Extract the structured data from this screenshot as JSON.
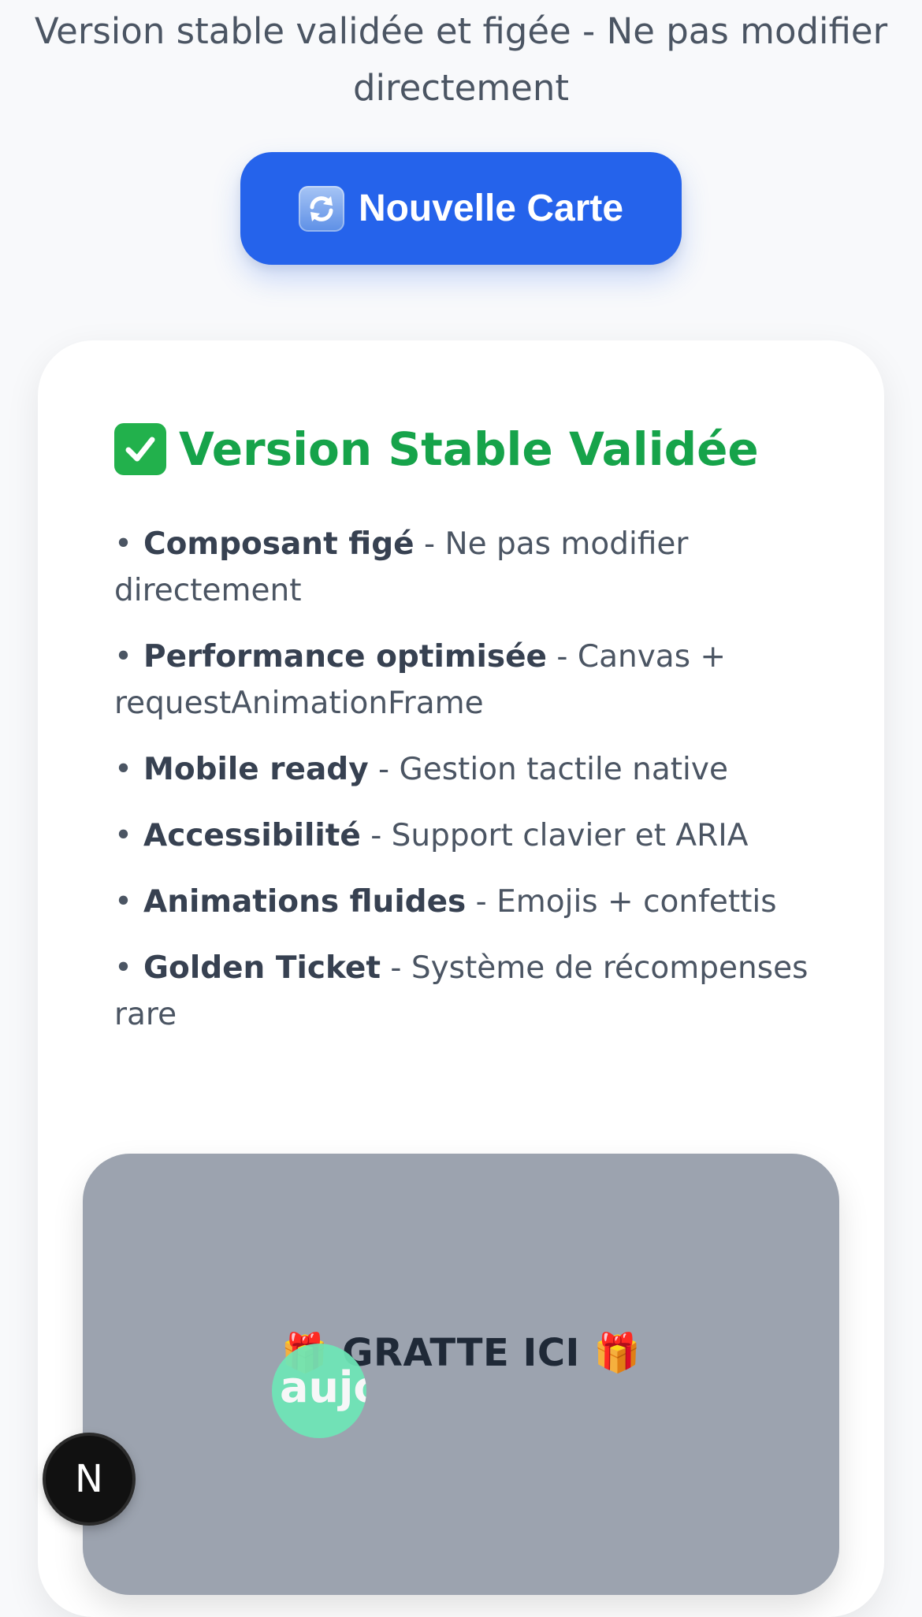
{
  "header": {
    "subtitle": "Version stable validée et figée - Ne pas modifier directement"
  },
  "actions": {
    "new_card_label": "Nouvelle Carte",
    "new_card_icon": "refresh-icon"
  },
  "status": {
    "title": "Version Stable Validée",
    "icon": "check-mark-icon",
    "color": "#16a34a"
  },
  "features": [
    {
      "title": "Composant figé",
      "desc": " - Ne pas modifier directement"
    },
    {
      "title": "Performance optimisée",
      "desc": " - Canvas + requestAnimationFrame"
    },
    {
      "title": "Mobile ready",
      "desc": " - Gestion tactile native"
    },
    {
      "title": "Accessibilité",
      "desc": " - Support clavier et ARIA"
    },
    {
      "title": "Animations fluides",
      "desc": " - Emojis + confettis"
    },
    {
      "title": "Golden Ticket",
      "desc": " - Système de récompenses rare"
    }
  ],
  "scratch_card": {
    "label": "GRATTE ICI",
    "revealed_text": "aujo",
    "icon": "gift-icon"
  },
  "dev_badge": {
    "letter": "N"
  },
  "colors": {
    "accent": "#2563eb",
    "success": "#16a34a",
    "scratch_surface": "#9ca3af",
    "reveal": "#6ee7b7"
  }
}
